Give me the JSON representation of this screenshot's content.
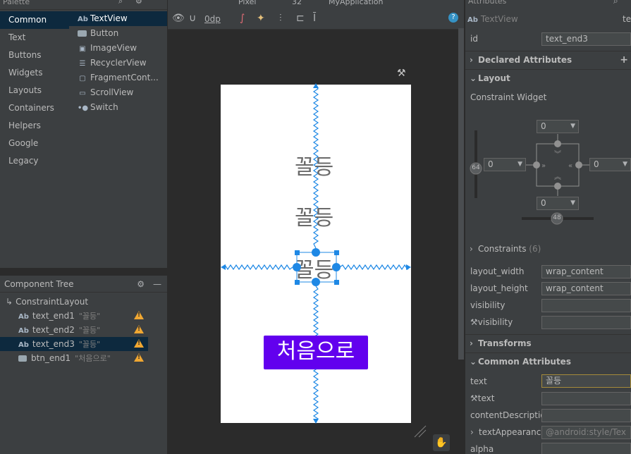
{
  "palette": {
    "title": "Palette",
    "categories": [
      "Common",
      "Text",
      "Buttons",
      "Widgets",
      "Layouts",
      "Containers",
      "Helpers",
      "Google",
      "Legacy"
    ],
    "items": [
      "TextView",
      "Button",
      "ImageView",
      "RecyclerView",
      "FragmentCont...",
      "ScrollView",
      "Switch"
    ]
  },
  "tree": {
    "title": "Component Tree",
    "root": "ConstraintLayout",
    "rows": [
      {
        "name": "text_end1",
        "text": "\"꼴등\""
      },
      {
        "name": "text_end2",
        "text": "\"꼴등\""
      },
      {
        "name": "text_end3",
        "text": "\"꼴등\""
      },
      {
        "name": "btn_end1",
        "text": "\"처음으로\""
      }
    ]
  },
  "toolbar": {
    "margin": "0dp",
    "device": "Pixel",
    "api": "32",
    "app": "MyApplication"
  },
  "design": {
    "label1": "꼴등",
    "label2": "꼴등",
    "label3": "꼴등",
    "button": "처음으로"
  },
  "attributes": {
    "header": "Attributes",
    "class_label": "TextView",
    "header_right": "te",
    "id_label": "id",
    "id_value": "text_end3",
    "declared": "Declared Attributes",
    "layout": "Layout",
    "constraint_widget": "Constraint Widget",
    "margins": {
      "top": "0",
      "left": "0",
      "right": "0",
      "bottom": "0"
    },
    "bias_left": "64",
    "bias_bottom": "48",
    "constraints": "Constraints",
    "constraints_count": "(6)",
    "layout_width_label": "layout_width",
    "layout_width_value": "wrap_content",
    "layout_height_label": "layout_height",
    "layout_height_value": "wrap_content",
    "visibility_label": "visibility",
    "tools_visibility_label": "visibility",
    "transforms": "Transforms",
    "common": "Common Attributes",
    "text_label": "text",
    "text_value": "꼴등",
    "tools_text_label": "text",
    "content_desc_label": "contentDescription",
    "text_appearance_label": "textAppearance",
    "text_appearance_value": "@android:style/Tex",
    "alpha_label": "alpha"
  }
}
